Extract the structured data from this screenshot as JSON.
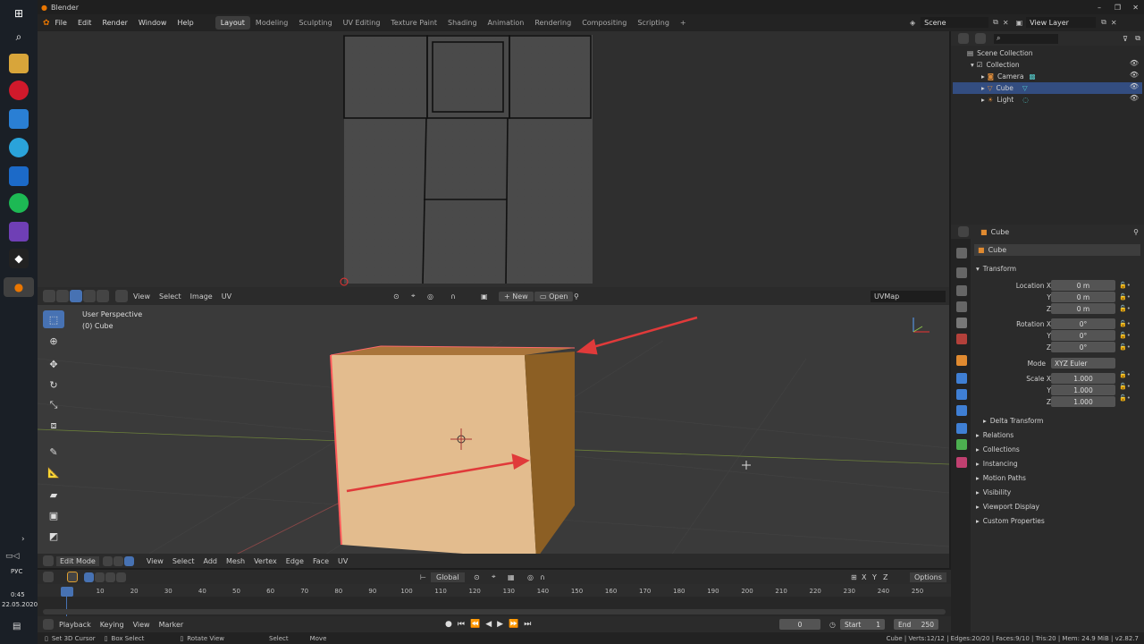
{
  "app": {
    "title": "Blender"
  },
  "menu": [
    "File",
    "Edit",
    "Render",
    "Window",
    "Help"
  ],
  "workspaces": [
    "Layout",
    "Modeling",
    "Sculpting",
    "UV Editing",
    "Texture Paint",
    "Shading",
    "Animation",
    "Rendering",
    "Compositing",
    "Scripting"
  ],
  "scene": {
    "name": "Scene",
    "view_layer": "View Layer"
  },
  "uv_header": {
    "menus": [
      "View",
      "Select",
      "Image",
      "UV"
    ],
    "new_label": "New",
    "open_label": "Open",
    "uvmap": "UVMap"
  },
  "viewport": {
    "title": "User Perspective",
    "object": "(0) Cube",
    "mode": "Edit Mode",
    "menus": [
      "View",
      "Select",
      "Add",
      "Mesh",
      "Vertex",
      "Edge",
      "Face",
      "UV"
    ],
    "transform_orientation": "Global",
    "options_label": "Options",
    "axes": [
      "X",
      "Y",
      "Z"
    ]
  },
  "outliner": {
    "root": "Scene Collection",
    "collection": "Collection",
    "items": [
      {
        "label": "Camera",
        "color": "#d9893a"
      },
      {
        "label": "Cube",
        "color": "#d9893a"
      },
      {
        "label": "Light",
        "color": "#d9893a"
      }
    ]
  },
  "properties": {
    "object_name": "Cube",
    "data_name": "Cube",
    "transform_label": "Transform",
    "location": {
      "label": "Location X",
      "x": "0 m",
      "y": "0 m",
      "z": "0 m"
    },
    "rotation": {
      "label": "Rotation X",
      "x": "0°",
      "y": "0°",
      "z": "0°"
    },
    "mode": {
      "label": "Mode",
      "value": "XYZ Euler"
    },
    "scale": {
      "label": "Scale X",
      "x": "1.000",
      "y": "1.000",
      "z": "1.000"
    },
    "axis_y": "Y",
    "axis_z": "Z",
    "delta": "Delta Transform",
    "sections": [
      "Relations",
      "Collections",
      "Instancing",
      "Motion Paths",
      "Visibility",
      "Viewport Display",
      "Custom Properties"
    ]
  },
  "timeline": {
    "ticks": [
      "0",
      "10",
      "20",
      "30",
      "40",
      "50",
      "60",
      "70",
      "80",
      "90",
      "100",
      "110",
      "120",
      "130",
      "140",
      "150",
      "160",
      "170",
      "180",
      "190",
      "200",
      "210",
      "220",
      "230",
      "240",
      "250"
    ],
    "menus": [
      "Playback",
      "Keying",
      "View",
      "Marker"
    ],
    "current_frame": "0",
    "start_label": "Start",
    "start": "1",
    "end_label": "End",
    "end": "250"
  },
  "status": {
    "left": [
      "Set 3D Cursor",
      "Box Select",
      "Rotate View",
      "Select",
      "Move"
    ],
    "right": "Cube | Verts:12/12 | Edges:20/20 | Faces:9/10 | Tris:20 | Mem: 24.9 MiB | v2.82.7"
  },
  "system": {
    "lang": "РУС",
    "time": "0:45",
    "date": "22.05.2020"
  },
  "colors": {
    "accent": "#4772b3",
    "cube_face": "#e3bc8e",
    "cube_side": "#8c5f24",
    "arrow": "#e03a3a"
  }
}
